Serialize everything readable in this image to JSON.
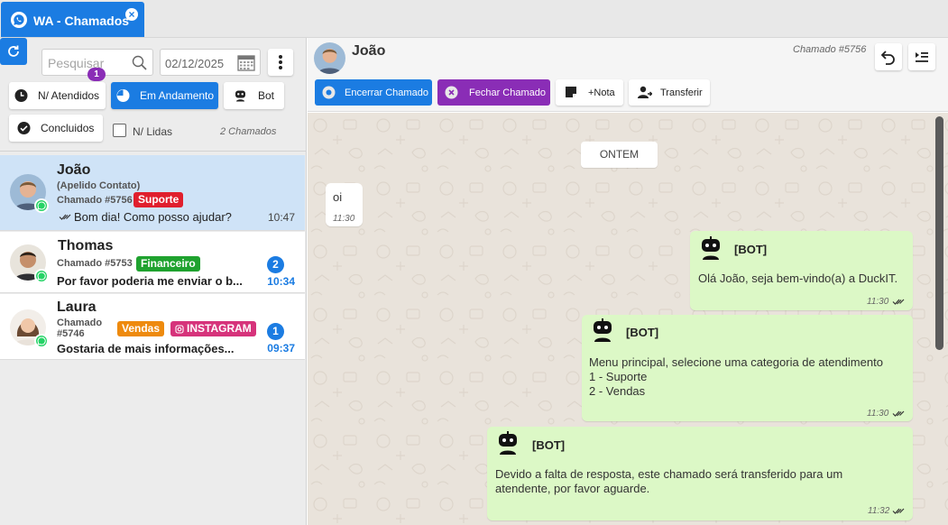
{
  "tab": {
    "label": "WA - Chamados",
    "close": "×"
  },
  "toolbar": {
    "search_placeholder": "Pesquisar",
    "search_badge": "1",
    "date": "02/12/2025"
  },
  "filters": {
    "nao_atendidos": "N/ Atendidos",
    "em_andamento": "Em Andamento",
    "bot": "Bot",
    "concluidos": "Concluidos",
    "nao_lidas": "N/ Lidas",
    "count": "2 Chamados"
  },
  "conversations": [
    {
      "name": "João",
      "nickname": "(Apelido Contato)",
      "ticket": "Chamado #5756",
      "tags": [
        "Suporte"
      ],
      "message": "Bom dia! Como posso ajudar?",
      "time": "10:47",
      "unread": ""
    },
    {
      "name": "Thomas",
      "ticket": "Chamado #5753",
      "tags": [
        "Financeiro"
      ],
      "message": "Por favor poderia me enviar o b...",
      "time": "10:34",
      "unread": "2"
    },
    {
      "name": "Laura",
      "ticket_line1": "Chamado",
      "ticket_line2": "#5746",
      "tags": [
        "Vendas",
        "INSTAGRAM"
      ],
      "message": "Gostaria de mais informações...",
      "time": "09:37",
      "unread": "1"
    }
  ],
  "colors": {
    "accent": "#1b7ce2",
    "purple": "#8a2db6",
    "suporte": "#e01f2d",
    "financeiro": "#1fa22f",
    "vendas": "#ee8a0e",
    "instagram": "#d6337b",
    "bubble_out": "#dcf8c6"
  },
  "chat_header": {
    "name": "João",
    "ticket": "Chamado #5756",
    "encerrar": "Encerrar Chamado",
    "fechar": "Fechar Chamado",
    "nota": "+Nota",
    "transferir": "Transferir"
  },
  "chat": {
    "day": "ONTEM",
    "messages": [
      {
        "dir": "in",
        "text": "oi",
        "time": "11:30"
      },
      {
        "dir": "out",
        "sender": "[BOT]",
        "text": "Olá João, seja bem-vindo(a) a DuckIT.",
        "time": "11:30"
      },
      {
        "dir": "out",
        "sender": "[BOT]",
        "text": "Menu principal, selecione uma categoria de atendimento\n1 - Suporte\n2 - Vendas",
        "time": "11:30"
      },
      {
        "dir": "out",
        "sender": "[BOT]",
        "text": "Devido a falta de resposta, este chamado será transferido para um\natendente, por favor aguarde.",
        "time": "11:32"
      }
    ]
  }
}
